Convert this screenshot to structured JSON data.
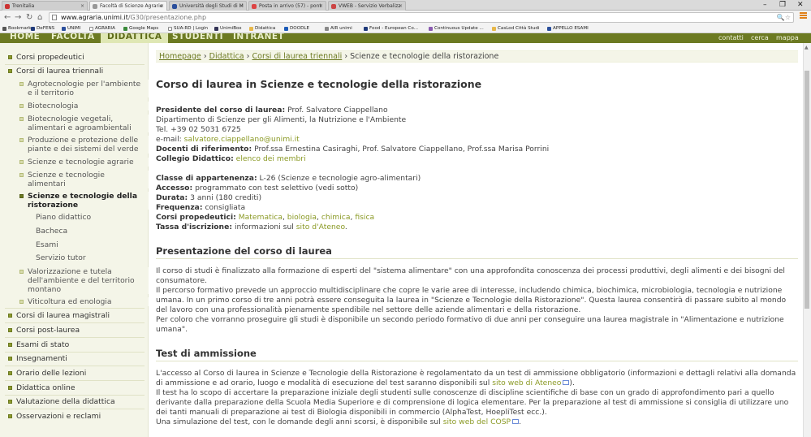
{
  "browser": {
    "tabs": [
      {
        "label": "Trenitalia"
      },
      {
        "label": "Facoltà di Scienze Agrarie"
      },
      {
        "label": "Università degli Studi di M"
      },
      {
        "label": "Posta in arrivo (57) - pont"
      },
      {
        "label": "VWEB - Servizio Verbalizz"
      }
    ],
    "url_host": "www.agraria.unimi.it",
    "url_path": "/G30/presentazione.php",
    "bookmarks": [
      "Bookmarks",
      "DeFENS",
      "UNIMI",
      "AGRARIA",
      "Google Maps",
      "SUA-RD | Login",
      "UnimiBox",
      "Didattica",
      "DOODLE",
      "AIR unimi",
      "Food - European Co...",
      "Continuous Update ...",
      "CasLod Città Studi",
      "APPELLO ESAMI"
    ]
  },
  "topnav": {
    "items": [
      "HOME",
      "FACOLTÀ",
      "DIDATTICA",
      "STUDENTI",
      "INTRANET"
    ],
    "right": [
      "contatti",
      "cerca",
      "mappa"
    ]
  },
  "sidebar": {
    "top": [
      "Corsi propedeutici",
      "Corsi di laurea triennali"
    ],
    "sub": [
      "Agrotecnologie per l'ambiente e il territorio",
      "Biotecnologia",
      "Biotecnologie vegetali, alimentari e agroambientali",
      "Produzione e protezione delle piante e dei sistemi del verde",
      "Scienze e tecnologie agrarie",
      "Scienze e tecnologie alimentari",
      "Scienze e tecnologie della ristorazione"
    ],
    "sub3": [
      "Piano didattico",
      "Bacheca",
      "Esami",
      "Servizio tutor"
    ],
    "sub_after": [
      "Valorizzazione e tutela dell'ambiente e del territorio montano",
      "Viticoltura ed enologia"
    ],
    "bottom": [
      "Corsi di laurea magistrali",
      "Corsi post-laurea",
      "Esami di stato",
      "Insegnamenti",
      "Orario delle lezioni",
      "Didattica online",
      "Valutazione della didattica",
      "Osservazioni e reclami"
    ]
  },
  "breadcrumb": {
    "items": [
      "Homepage",
      "Didattica",
      "Corsi di laurea triennali"
    ],
    "current": "Scienze e tecnologie della ristorazione",
    "sep": "›"
  },
  "page": {
    "title": "Corso di laurea in Scienze e tecnologie della ristorazione",
    "presidente_label": "Presidente del corso di laurea:",
    "presidente": "Prof. Salvatore Ciappellano",
    "dipartimento": "Dipartimento di Scienze per gli Alimenti, la Nutrizione e l'Ambiente",
    "tel": "Tel. +39 02 5031 6725",
    "email_label": "e-mail:",
    "email": "salvatore.ciappellano@unimi.it",
    "docenti_label": "Docenti di riferimento:",
    "docenti": "Prof.ssa Ernestina Casiraghi, Prof. Salvatore Ciappellano, Prof.ssa Marisa Porrini",
    "collegio_label": "Collegio Didattico:",
    "collegio_link": "elenco dei membri",
    "classe_label": "Classe di appartenenza:",
    "classe": "L-26 (Scienze e tecnologie agro-alimentari)",
    "accesso_label": "Accesso:",
    "accesso": "programmato con test selettivo (vedi sotto)",
    "durata_label": "Durata:",
    "durata": "3 anni (180 crediti)",
    "frequenza_label": "Frequenza:",
    "frequenza": "consigliata",
    "corsi_label": "Corsi propedeutici:",
    "corsi_links": [
      "Matematica",
      "biologia",
      "chimica",
      "fisica"
    ],
    "tassa_label": "Tassa d'iscrizione:",
    "tassa_text": "informazioni sul",
    "tassa_link": "sito d'Ateneo",
    "section1_title": "Presentazione del corso di laurea",
    "p1": "Il corso di studi è finalizzato alla formazione di esperti del \"sistema alimentare\" con una approfondita conoscenza dei processi produttivi, degli alimenti e dei bisogni del consumatore.",
    "p2": "Il percorso formativo prevede un approccio multidisciplinare che copre le varie aree di interesse, includendo chimica, biochimica, microbiologia, tecnologia e nutrizione umana. In un primo corso di tre anni potrà essere conseguita la laurea in \"Scienze e Tecnologie della Ristorazione\". Questa laurea consentirà di passare subito al mondo del lavoro con una professionalità pienamente spendibile nel settore delle aziende alimentari e della ristorazione.",
    "p3": "Per coloro che vorranno proseguire gli studi è disponibile un secondo periodo formativo di due anni per conseguire una laurea magistrale in \"Alimentazione e nutrizione umana\".",
    "section2_title": "Test di ammissione",
    "t1": "L'accesso al Corso di laurea in Scienze e Tecnologie della Ristorazione è regolamentato da un test di ammissione obbligatorio (informazioni e dettagli relativi alla domanda di ammissione e ad orario, luogo e modalità di esecuzione del test saranno disponibili sul",
    "t1_link": "sito web di Ateneo",
    "t2": "Il test ha lo scopo di accertare la preparazione iniziale degli studenti sulle conoscenze di discipline scientifiche di base con un grado di approfondimento pari a quello derivante dalla preparazione della Scuola Media Superiore e di comprensione di logica elementare. Per la preparazione al test di ammissione si consiglia di utilizzare uno dei tanti manuali di preparazione ai test di Biologia disponibili in commercio (AlphaTest, HoepliTest ecc.).",
    "t3": "Una simulazione del test, con le domande degli anni scorsi, è disponibile sul",
    "t3_link": "sito web del COSP"
  }
}
